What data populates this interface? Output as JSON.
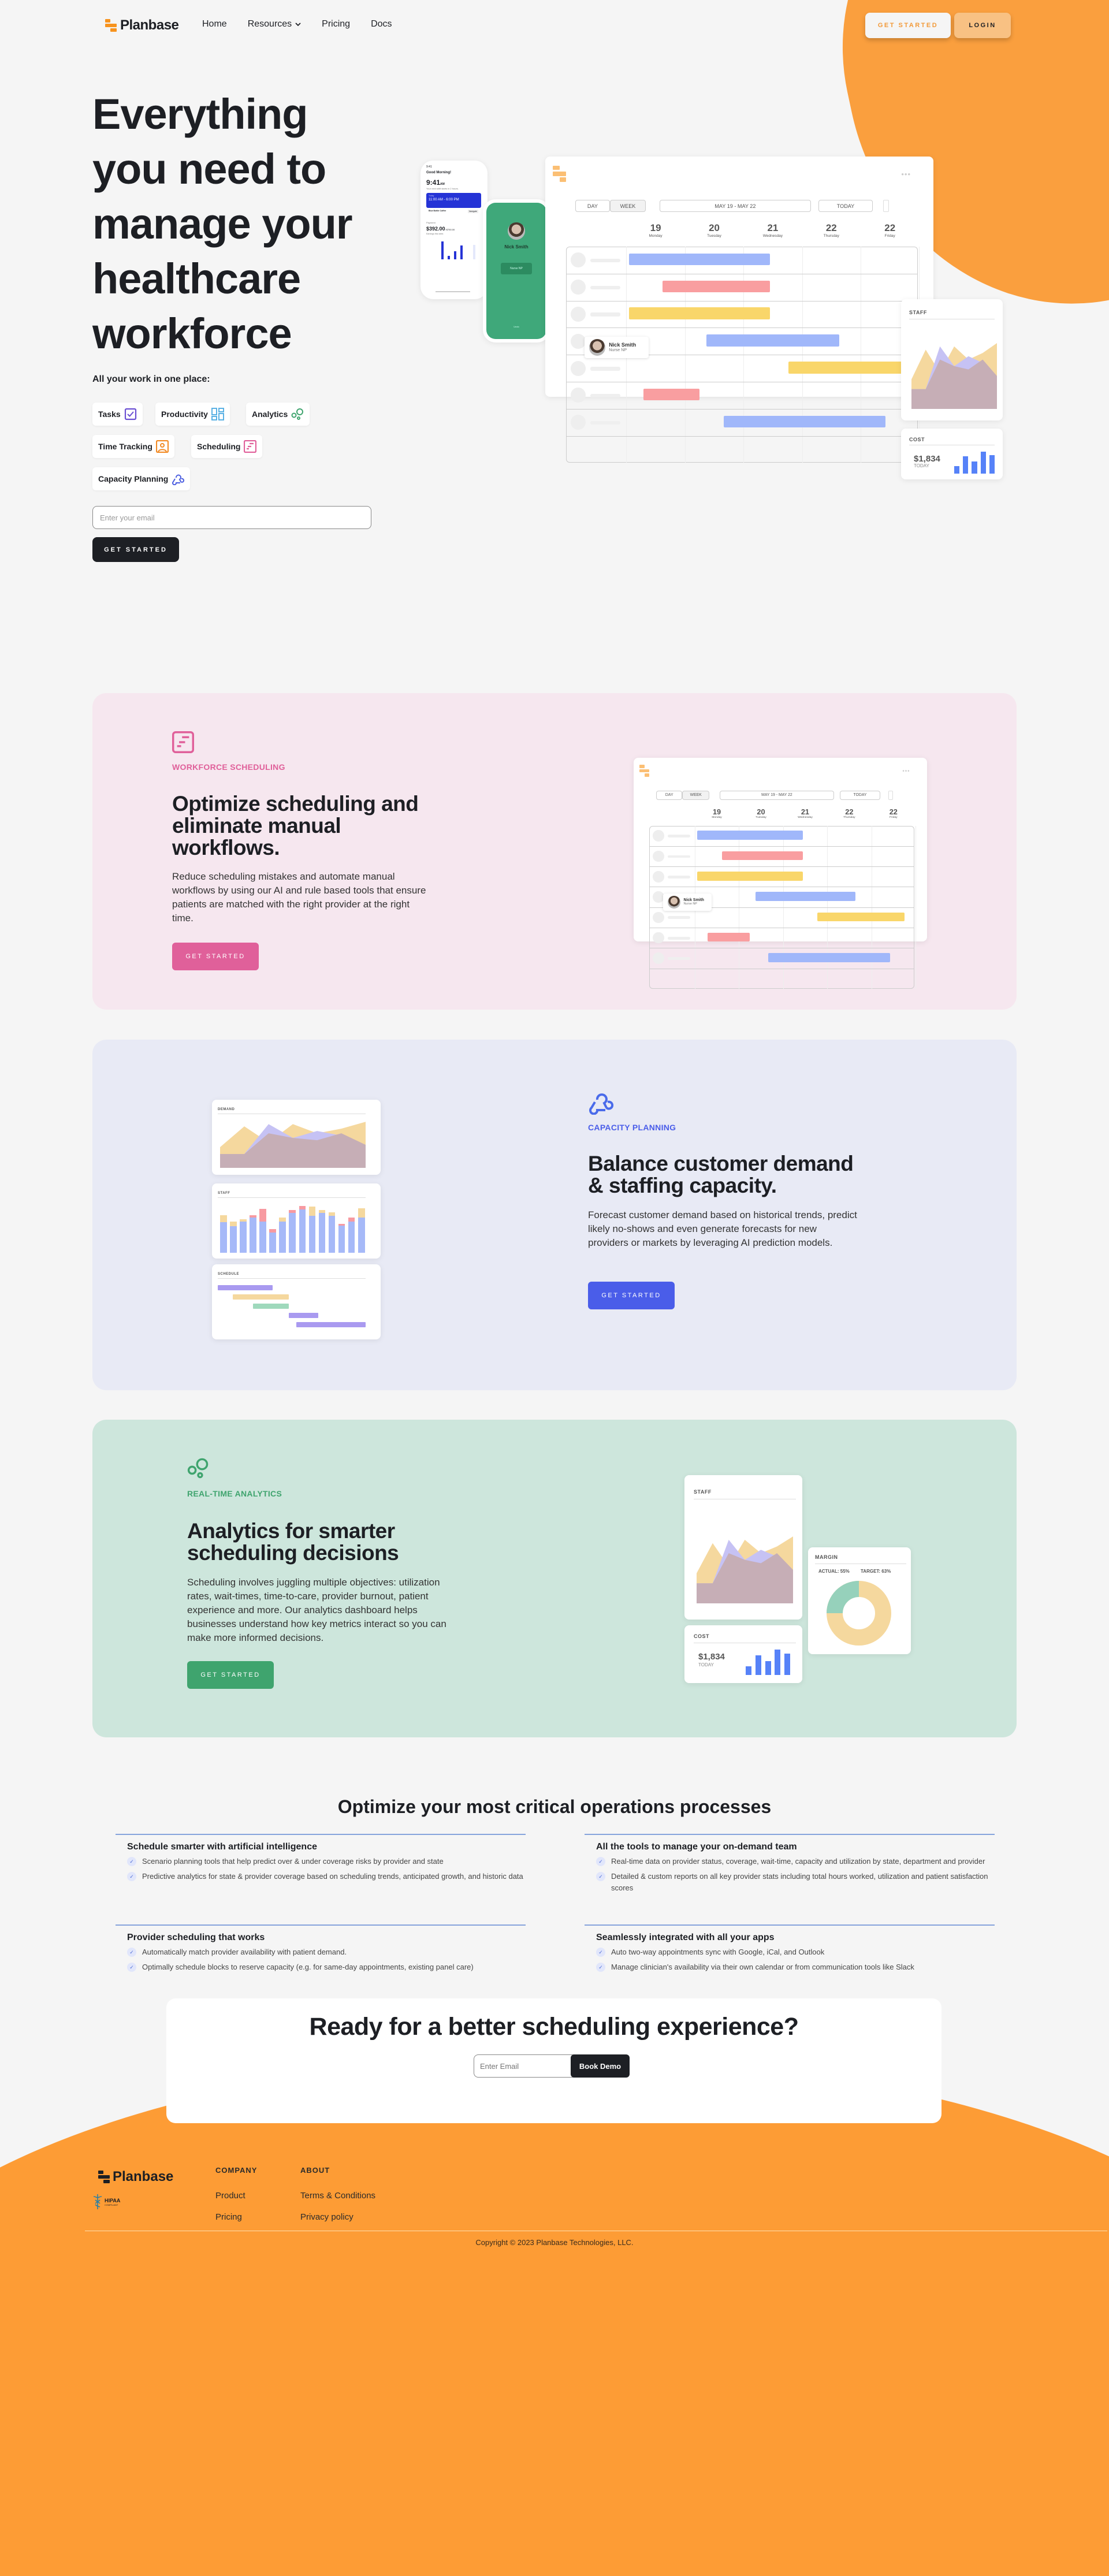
{
  "brand": {
    "name": "Planbase",
    "accent": "#fa9f3e"
  },
  "nav": {
    "links": [
      "Home",
      "Resources",
      "Pricing",
      "Docs"
    ],
    "get_started": "GET STARTED",
    "login": "LOGIN"
  },
  "hero": {
    "title": "Everything you need to manage your healthcare workforce",
    "subtitle": "All your work in one place:",
    "chips": [
      {
        "label": "Tasks",
        "icon": "checkbox-icon",
        "color": "#6b4fd3"
      },
      {
        "label": "Productivity",
        "icon": "dashboard-grid-icon",
        "color": "#5ab1e4"
      },
      {
        "label": "Analytics",
        "icon": "bubbles-icon",
        "color": "#3fa46e"
      },
      {
        "label": "Time Tracking",
        "icon": "user-badge-icon",
        "color": "#f28b25"
      },
      {
        "label": "Scheduling",
        "icon": "schedule-icon",
        "color": "#e0609a"
      },
      {
        "label": "Capacity Planning",
        "icon": "webhook-icon",
        "color": "#4a5de0"
      }
    ],
    "email_placeholder": "Enter your email",
    "cta": "GET STARTED"
  },
  "mock": {
    "phone1": {
      "time_small": "9:41",
      "greeting": "Good Morning!",
      "time": "9:41",
      "ampm": "AM",
      "next_shift": "Your next shift starts in 2 hours.",
      "shift_label": "Today",
      "shift": "11:00 AM - 6:00 PM",
      "place": "Blue Bottle Coffee",
      "navigate": "Navigate",
      "payment_label": "Payment",
      "amount": "$392.00",
      "amount_of": "/ $750.00",
      "amount_sub": "Earnings this week"
    },
    "phone2": {
      "name": "Nick Smith",
      "role": "Nurse NP",
      "undo": "Undo"
    },
    "calendar": {
      "views": [
        "DAY",
        "WEEK"
      ],
      "range": "MAY 19 - MAY 22",
      "today": "TODAY",
      "days": [
        {
          "num": "19",
          "name": "Monday"
        },
        {
          "num": "20",
          "name": "Tuesday"
        },
        {
          "num": "21",
          "name": "Wednesday"
        },
        {
          "num": "22",
          "name": "Thursday"
        },
        {
          "num": "22",
          "name": "Friday"
        }
      ],
      "shifts": [
        {
          "row": 0,
          "start": 0.05,
          "end": 2.45,
          "color": "#a0b7fa"
        },
        {
          "row": 1,
          "start": 0.62,
          "end": 2.45,
          "color": "#f99ea0"
        },
        {
          "row": 2,
          "start": 0.05,
          "end": 2.45,
          "color": "#f9d66a"
        },
        {
          "row": 3,
          "start": 1.37,
          "end": 3.64,
          "color": "#a0b7fa"
        },
        {
          "row": 4,
          "start": 2.77,
          "end": 4.75,
          "color": "#f9d66a"
        },
        {
          "row": 5,
          "start": 0.29,
          "end": 1.25,
          "color": "#f99ea0"
        },
        {
          "row": 6,
          "start": 1.66,
          "end": 4.42,
          "color": "#a0b7fa"
        }
      ],
      "tooltip": {
        "name": "Nick Smith",
        "role": "Nurse NP"
      }
    },
    "staff_label": "STAFF",
    "cost_label": "COST",
    "cost_value": "$1,834",
    "cost_sub": "TODAY",
    "cost_bars": [
      0.35,
      0.78,
      0.55,
      1.0,
      0.84
    ],
    "staff_area_series": [
      {
        "name": "demand",
        "color": "#f5d89e",
        "values": [
          0.45,
          0.9,
          0.55,
          0.95,
          0.75,
          0.85,
          1.0
        ]
      },
      {
        "name": "overlap",
        "color": "#c6c2f4",
        "values": [
          0.3,
          0.3,
          0.95,
          0.65,
          0.8,
          0.7,
          0.5
        ]
      },
      {
        "name": "staff",
        "color": "#c6aeb6",
        "values": [
          0.3,
          0.3,
          0.75,
          0.65,
          0.6,
          0.75,
          0.5
        ]
      }
    ]
  },
  "sections": [
    {
      "key": "scheduling",
      "eyebrow": "WORKFORCE SCHEDULING",
      "title": "Optimize scheduling and eliminate manual workflows.",
      "body": "Reduce scheduling mistakes and automate manual workflows by using our AI and rule based tools that ensure patients are matched with the right provider at the right time.",
      "cta": "GET STARTED",
      "color": "#e0609a",
      "bg": "#f6e7ef"
    },
    {
      "key": "capacity",
      "eyebrow": "CAPACITY PLANNING",
      "title": "Balance customer demand & staffing capacity.",
      "body": "Forecast customer demand based on historical trends, predict likely no-shows and even generate forecasts for new providers or markets by leveraging AI prediction models.",
      "cta": "GET STARTED",
      "color": "#4a5de9",
      "bg": "#e8eaf5",
      "widgets": {
        "demand_label": "DEMAND",
        "staff_label": "STAFF",
        "schedule_label": "SCHEDULE",
        "staff_bars": [
          {
            "base": 0.66,
            "yellow": 0.15,
            "red": 0
          },
          {
            "base": 0.58,
            "yellow": 0.09,
            "red": 0
          },
          {
            "base": 0.67,
            "yellow": 0.05,
            "red": 0
          },
          {
            "base": 0.76,
            "yellow": 0,
            "red": 0.05
          },
          {
            "base": 0.67,
            "yellow": 0,
            "red": 0.28
          },
          {
            "base": 0.44,
            "yellow": 0,
            "red": 0.07
          },
          {
            "base": 0.67,
            "yellow": 0.09,
            "red": 0
          },
          {
            "base": 0.86,
            "yellow": 0,
            "red": 0.07
          },
          {
            "base": 0.94,
            "yellow": 0,
            "red": 0.07
          },
          {
            "base": 0.8,
            "yellow": 0.2,
            "red": 0
          },
          {
            "base": 0.86,
            "yellow": 0.07,
            "red": 0
          },
          {
            "base": 0.8,
            "yellow": 0.07,
            "red": 0
          },
          {
            "base": 0.59,
            "yellow": 0,
            "red": 0.03
          },
          {
            "base": 0.67,
            "yellow": 0,
            "red": 0.09
          },
          {
            "base": 0.76,
            "yellow": 0.2,
            "red": 0
          }
        ],
        "schedule_bars": [
          {
            "start": 0.0,
            "end": 0.37,
            "color": "#a99af0"
          },
          {
            "start": 0.1,
            "end": 0.48,
            "color": "#f5d89e"
          },
          {
            "start": 0.24,
            "end": 0.48,
            "color": "#9fd9bc"
          },
          {
            "start": 0.48,
            "end": 0.68,
            "color": "#a99af0"
          },
          {
            "start": 0.53,
            "end": 1.0,
            "color": "#a99af0"
          }
        ]
      }
    },
    {
      "key": "analytics",
      "eyebrow": "REAL-TIME ANALYTICS",
      "title": "Analytics for smarter scheduling decisions",
      "body": "Scheduling involves juggling multiple objectives: utilization rates, wait-times, time-to-care, provider burnout, patient experience and more. Our analytics dashboard helps businesses understand how key metrics interact so you can make more informed decisions.",
      "cta": "GET STARTED",
      "color": "#3fa46e",
      "bg": "#cde6dc",
      "widgets": {
        "staff_label": "STAFF",
        "cost_label": "COST",
        "cost_value": "$1,834",
        "cost_sub": "TODAY",
        "margin_label": "MARGIN",
        "actual": "ACTUAL: 55%",
        "target": "TARGET: 63%",
        "donut": {
          "green_fraction": 0.25,
          "green": "#96d1bb",
          "yellow": "#f5d89e"
        }
      }
    }
  ],
  "ops": {
    "title": "Optimize your most critical operations processes",
    "groups": [
      {
        "title": "Schedule smarter with artificial intelligence",
        "items": [
          "Scenario planning tools that help predict over & under coverage risks by provider and state",
          "Predictive analytics for state & provider coverage based on scheduling trends, anticipated growth, and historic data"
        ]
      },
      {
        "title": "All the tools to manage your on-demand team",
        "items": [
          "Real-time data on provider status, coverage, wait-time, capacity and utilization by state, department and provider",
          "Detailed & custom reports on all key provider stats including total hours worked, utilization and patient satisfaction scores"
        ]
      },
      {
        "title": "Provider scheduling that works",
        "items": [
          "Automatically match provider availability with patient demand.",
          "Optimally schedule blocks to reserve capacity (e.g. for same-day appointments, existing panel care)"
        ]
      },
      {
        "title": "Seamlessly integrated with all your apps",
        "items": [
          "Auto two-way appointments sync with Google, iCal, and Outlook",
          "Manage clinician's availability via their own calendar or from communication tools like Slack"
        ]
      }
    ]
  },
  "cta": {
    "title": "Ready for a better scheduling experience?",
    "placeholder": "Enter Email",
    "button": "Book Demo"
  },
  "footer": {
    "hipaa": "HIPAA",
    "hipaa_sub": "COMPLIANT",
    "columns": [
      {
        "title": "COMPANY",
        "links": [
          "Product",
          "Pricing"
        ]
      },
      {
        "title": "ABOUT",
        "links": [
          "Terms & Conditions",
          "Privacy policy"
        ]
      }
    ],
    "copyright": "Copyright © 2023 Planbase Technologies, LLC."
  }
}
